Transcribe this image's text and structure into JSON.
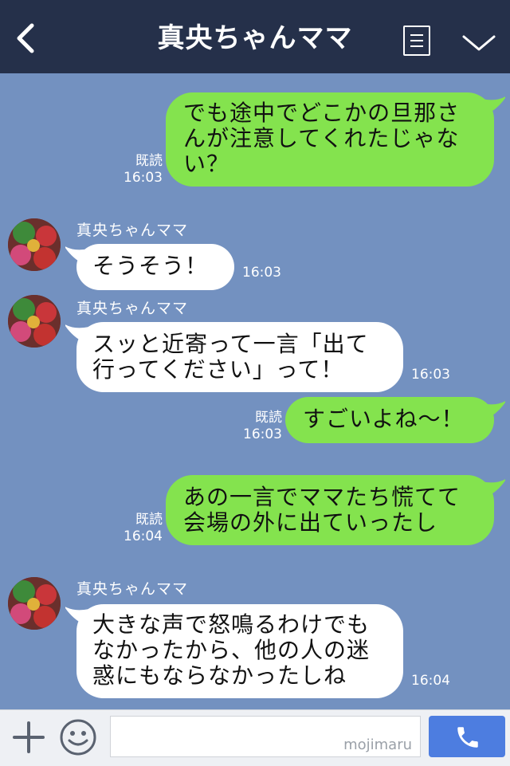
{
  "header": {
    "title": "真央ちゃんママ"
  },
  "messages": [
    {
      "type": "out",
      "line1": "でも途中でどこかの旦那さ",
      "line2": "んが注意してくれたじゃな",
      "line3": "い？",
      "read": "既読",
      "time": "16:03"
    },
    {
      "type": "in",
      "sender": "真央ちゃんママ",
      "line1": "そうそう！",
      "time": "16:03"
    },
    {
      "type": "in",
      "sender": "真央ちゃんママ",
      "line1": "スッと近寄って一言「出て",
      "line2": "行ってください」って！",
      "time": "16:03"
    },
    {
      "type": "out",
      "line1": "すごいよね〜！",
      "read": "既読",
      "time": "16:03"
    },
    {
      "type": "out",
      "line1": "あの一言でママたち慌てて",
      "line2": "会場の外に出ていったし",
      "read": "既読",
      "time": "16:04"
    },
    {
      "type": "in",
      "sender": "真央ちゃんママ",
      "line1": "大きな声で怒鳴るわけでも",
      "line2": "なかったから、他の人の迷",
      "line3": "惑にもならなかったしね",
      "time": "16:04"
    }
  ],
  "input": {
    "watermark": "mojimaru"
  },
  "icons": {
    "back": "chevron-left-icon",
    "menu": "note-menu-icon",
    "collapse": "chevron-down-icon",
    "add": "plus-icon",
    "sticker": "smiley-icon",
    "call": "phone-icon"
  },
  "colors": {
    "header_bg": "#25304a",
    "chat_bg": "#7391c0",
    "out_bubble": "#84e34e",
    "in_bubble": "#ffffff",
    "call_button": "#4d7de0"
  }
}
